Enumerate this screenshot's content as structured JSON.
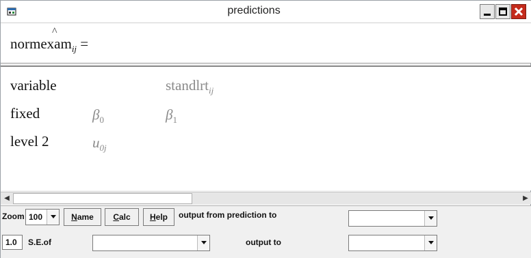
{
  "window": {
    "title": "predictions"
  },
  "equation": {
    "lhs": "normexam",
    "hat_char": "^",
    "subscript": "ij",
    "rhs": "="
  },
  "table": {
    "rows": [
      {
        "label": "variable",
        "cols": [
          {
            "text": "standlrt",
            "sub": "ij"
          }
        ]
      },
      {
        "label": "fixed",
        "cols": [
          {
            "text": "β",
            "sub": "0"
          },
          {
            "text": "β",
            "sub": "1"
          }
        ]
      },
      {
        "label": "level 2",
        "cols": [
          {
            "text": "u",
            "sub": "0j"
          }
        ]
      }
    ]
  },
  "toolbar": {
    "zoom_label": "Zoom",
    "zoom_value": "100",
    "name_button": {
      "first": "N",
      "rest": "ame"
    },
    "calc_button": {
      "first": "C",
      "rest": "alc"
    },
    "help_button": {
      "first": "H",
      "rest": "elp"
    },
    "output_from_label": "output from prediction to",
    "output_from_value": "",
    "multiplier_value": "1.0",
    "se_label": "S.E.of",
    "se_value": "",
    "output_to_label": "output to",
    "output_to_value": ""
  },
  "scrollbar": {
    "left_arrow": "◀",
    "right_arrow": "▶"
  },
  "colors": {
    "close_button": "#c42b1c",
    "gray_text": "#8a8a8a",
    "pane_bg": "#ffffff"
  },
  "icons": [
    "app-icon",
    "minimize-icon",
    "maximize-icon",
    "close-icon",
    "chevron-down-icon",
    "scroll-left-icon",
    "scroll-right-icon"
  ]
}
